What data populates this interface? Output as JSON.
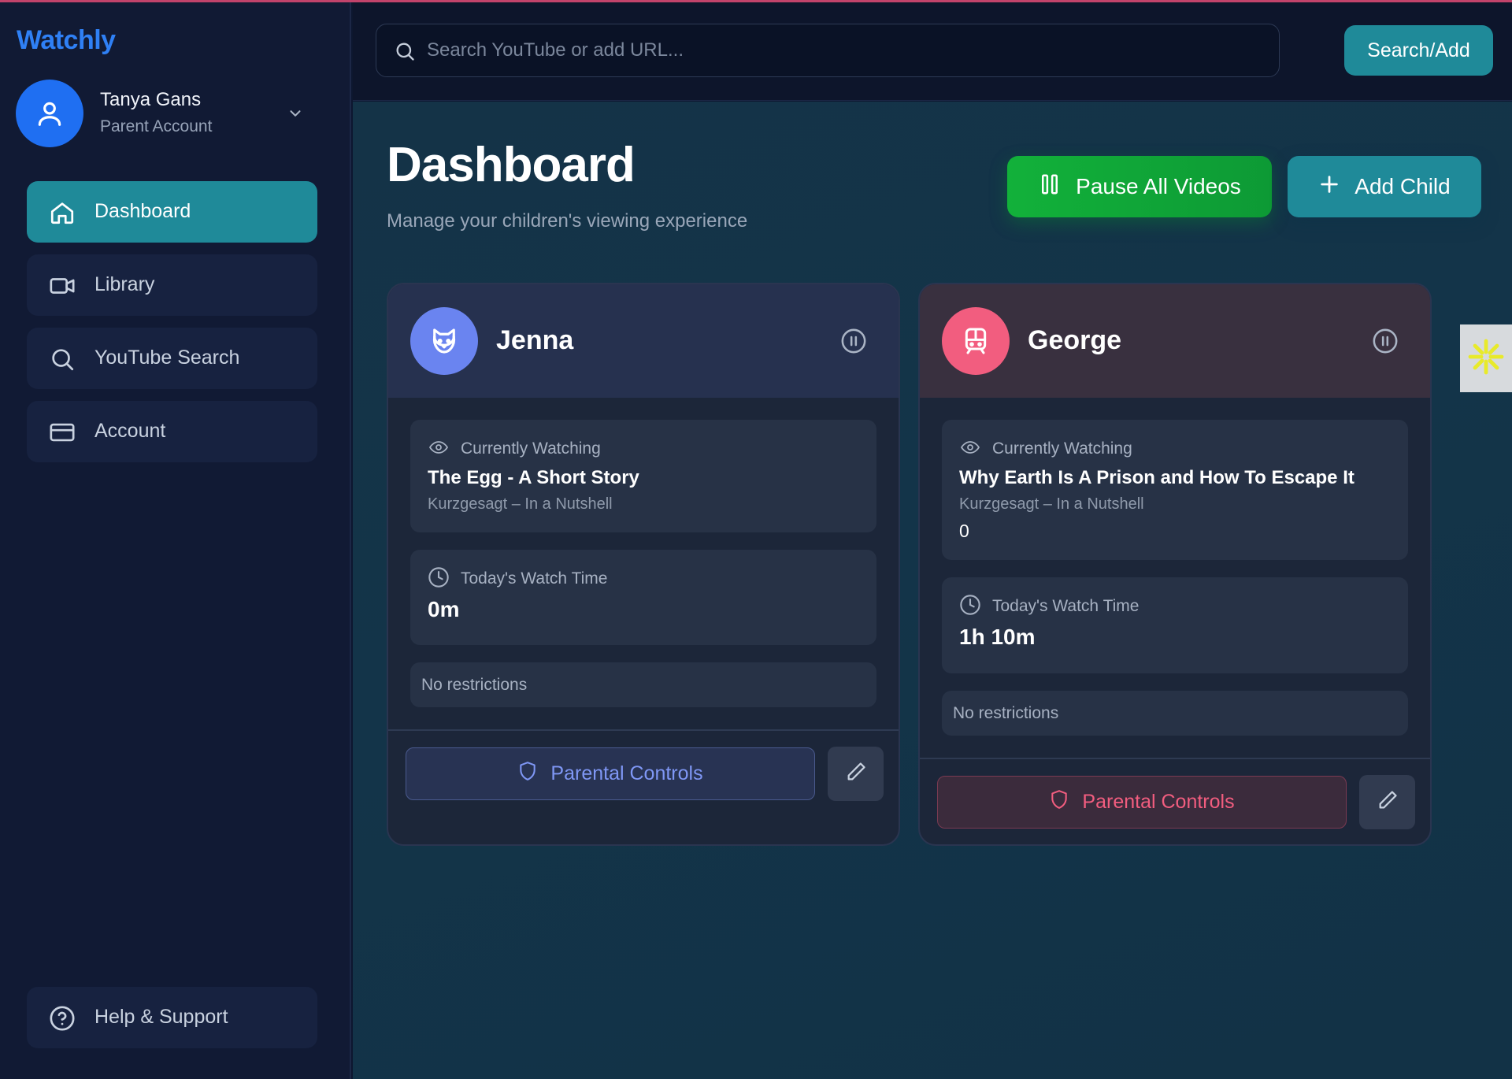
{
  "app": {
    "logo": "Watchly"
  },
  "user": {
    "name": "Tanya Gans",
    "role": "Parent Account"
  },
  "sidebar": {
    "items": [
      {
        "label": "Dashboard",
        "icon": "home-icon",
        "active": true
      },
      {
        "label": "Library",
        "icon": "video-camera-icon",
        "active": false
      },
      {
        "label": "YouTube Search",
        "icon": "search-icon",
        "active": false
      },
      {
        "label": "Account",
        "icon": "credit-card-icon",
        "active": false
      }
    ],
    "help": {
      "label": "Help & Support",
      "icon": "help-circle-icon"
    }
  },
  "search": {
    "placeholder": "Search YouTube or add URL...",
    "value": "",
    "button_label": "Search/Add"
  },
  "main": {
    "title": "Dashboard",
    "subtitle": "Manage your children's viewing experience",
    "pause_all_label": "Pause All Videos",
    "add_child_label": "Add Child"
  },
  "children": [
    {
      "name": "Jenna",
      "avatar_icon": "cat-face-icon",
      "avatar_color": "#6a84f0",
      "currently_watching_label": "Currently Watching",
      "video_title": "The Egg - A Short Story",
      "channel": "Kurzgesagt – In a Nutshell",
      "extra": "",
      "watch_time_label": "Today's Watch Time",
      "watch_time": "0m",
      "restrictions": "No restrictions",
      "controls_label": "Parental Controls"
    },
    {
      "name": "George",
      "avatar_icon": "train-icon",
      "avatar_color": "#f25d7f",
      "currently_watching_label": "Currently Watching",
      "video_title": "Why Earth Is A Prison and How To Escape It",
      "channel": "Kurzgesagt – In a Nutshell",
      "extra": "0",
      "watch_time_label": "Today's Watch Time",
      "watch_time": "1h 10m",
      "restrictions": "No restrictions",
      "controls_label": "Parental Controls"
    }
  ],
  "colors": {
    "accent": "#1f8a99",
    "brand": "#2f80f5",
    "pause_green": "#12b13a",
    "jenna": "#7f97f5",
    "george": "#f25d7f"
  }
}
